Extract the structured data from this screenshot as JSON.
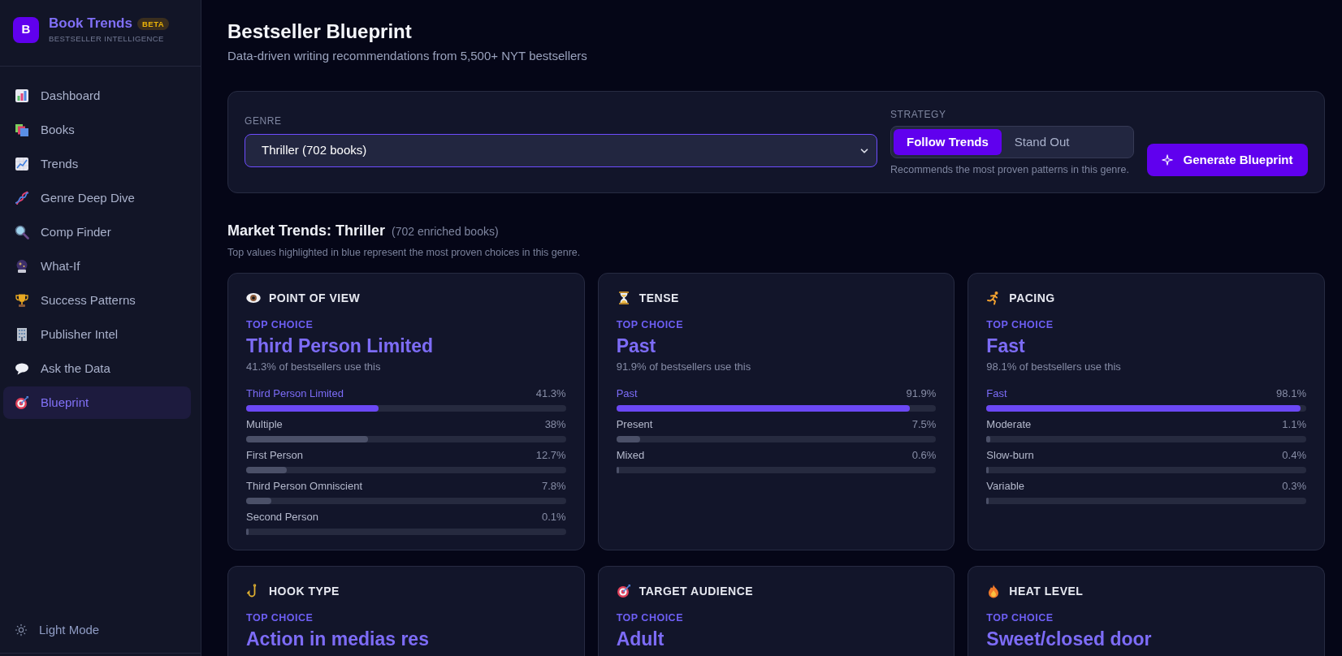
{
  "sidebar": {
    "brand": {
      "logo_letter": "B",
      "name": "Book Trends",
      "badge": "BETA",
      "tagline": "BESTSELLER INTELLIGENCE"
    },
    "nav_items": [
      {
        "label": "Dashboard",
        "selected": false
      },
      {
        "label": "Books",
        "selected": false
      },
      {
        "label": "Trends",
        "selected": false
      },
      {
        "label": "Genre Deep Dive",
        "selected": false
      },
      {
        "label": "Comp Finder",
        "selected": false
      },
      {
        "label": "What-If",
        "selected": false
      },
      {
        "label": "Success Patterns",
        "selected": false
      },
      {
        "label": "Publisher Intel",
        "selected": false
      },
      {
        "label": "Ask the Data",
        "selected": false
      },
      {
        "label": "Blueprint",
        "selected": true
      }
    ],
    "theme_toggle": {
      "label": "Light Mode"
    }
  },
  "header": {
    "title": "Bestseller Blueprint",
    "subtitle": "Data-driven writing recommendations from 5,500+ NYT bestsellers"
  },
  "controls": {
    "genre": {
      "label": "GENRE",
      "value": "Thriller (702 books)"
    },
    "strategy": {
      "label": "STRATEGY",
      "options": [
        {
          "label": "Follow Trends",
          "selected": true
        },
        {
          "label": "Stand Out",
          "selected": false
        }
      ],
      "hint": "Recommends the most proven patterns in this genre."
    },
    "generate_button": {
      "label": "Generate Blueprint"
    }
  },
  "market_trends": {
    "title": "Market Trends: Thriller",
    "count": "(702 enriched books)",
    "caption": "Top values highlighted in blue represent the most proven choices in this genre.",
    "cards": [
      {
        "title": "POINT OF VIEW",
        "top_label": "TOP CHOICE",
        "top_value": "Third Person Limited",
        "top_share": "41.3% of bestsellers use this",
        "options": [
          {
            "label": "Third Person Limited",
            "reading": "41.3%",
            "level": 0.413,
            "highlighted": true
          },
          {
            "label": "Multiple",
            "reading": "38%",
            "level": 0.38,
            "highlighted": false
          },
          {
            "label": "First Person",
            "reading": "12.7%",
            "level": 0.127,
            "highlighted": false
          },
          {
            "label": "Third Person Omniscient",
            "reading": "7.8%",
            "level": 0.078,
            "highlighted": false
          },
          {
            "label": "Second Person",
            "reading": "0.1%",
            "level": 0.001,
            "highlighted": false
          }
        ]
      },
      {
        "title": "TENSE",
        "top_label": "TOP CHOICE",
        "top_value": "Past",
        "top_share": "91.9% of bestsellers use this",
        "options": [
          {
            "label": "Past",
            "reading": "91.9%",
            "level": 0.919,
            "highlighted": true
          },
          {
            "label": "Present",
            "reading": "7.5%",
            "level": 0.075,
            "highlighted": false
          },
          {
            "label": "Mixed",
            "reading": "0.6%",
            "level": 0.006,
            "highlighted": false
          }
        ]
      },
      {
        "title": "PACING",
        "top_label": "TOP CHOICE",
        "top_value": "Fast",
        "top_share": "98.1% of bestsellers use this",
        "options": [
          {
            "label": "Fast",
            "reading": "98.1%",
            "level": 0.981,
            "highlighted": true
          },
          {
            "label": "Moderate",
            "reading": "1.1%",
            "level": 0.011,
            "highlighted": false
          },
          {
            "label": "Slow-burn",
            "reading": "0.4%",
            "level": 0.004,
            "highlighted": false
          },
          {
            "label": "Variable",
            "reading": "0.3%",
            "level": 0.003,
            "highlighted": false
          }
        ]
      },
      {
        "title": "HOOK TYPE",
        "top_label": "TOP CHOICE",
        "top_value": "Action in medias res"
      },
      {
        "title": "TARGET AUDIENCE",
        "top_label": "TOP CHOICE",
        "top_value": "Adult"
      },
      {
        "title": "HEAT LEVEL",
        "top_label": "TOP CHOICE",
        "top_value": "Sweet/closed door"
      }
    ]
  }
}
